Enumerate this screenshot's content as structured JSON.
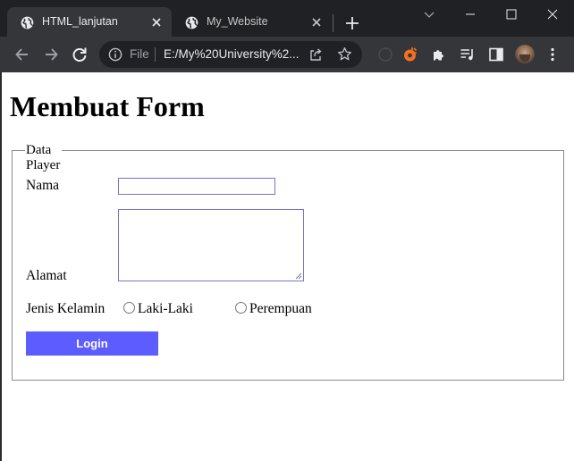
{
  "browser": {
    "tabs": [
      {
        "title": "HTML_lanjutan",
        "active": true,
        "icon": "globe-icon"
      },
      {
        "title": "My_Website",
        "active": false,
        "icon": "globe-icon"
      }
    ],
    "new_tab_icon": "plus-icon",
    "window_controls": [
      "chevron-down-icon",
      "minimize-icon",
      "maximize-icon",
      "close-icon"
    ],
    "address_bar": {
      "scheme_label": "File",
      "url": "E:/My%20University%2..."
    },
    "toolbar_icons": [
      "back-icon",
      "forward-icon",
      "reload-icon",
      "info-icon",
      "share-icon",
      "star-icon",
      "extension-orange-icon",
      "puzzle-icon",
      "reading-list-icon",
      "side-panel-icon",
      "avatar",
      "kebab-menu-icon"
    ],
    "colors": {
      "tabbar": "#202124",
      "toolbar": "#35363a",
      "extension_accent": "#f37021"
    }
  },
  "page": {
    "heading": "Membuat Form",
    "fieldset": {
      "legend": "Data Player",
      "fields": {
        "nama": {
          "label": "Nama",
          "value": ""
        },
        "alamat": {
          "label": "Alamat",
          "value": ""
        },
        "jenis_kelamin": {
          "label": "Jenis Kelamin",
          "options": [
            "Laki-Laki",
            "Perempuan"
          ],
          "selected": null
        }
      },
      "submit_label": "Login"
    },
    "colors": {
      "button": "#5d5cff",
      "input_border": "#7775c2"
    }
  }
}
